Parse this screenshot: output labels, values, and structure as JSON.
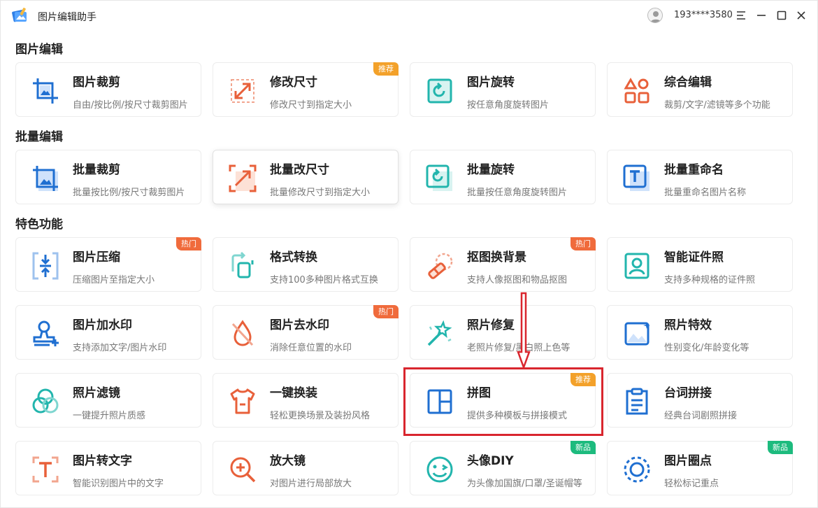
{
  "app": {
    "title": "图片编辑助手",
    "user_id": "193****3580"
  },
  "sections": {
    "edit": {
      "title": "图片编辑"
    },
    "batch": {
      "title": "批量编辑"
    },
    "special": {
      "title": "特色功能"
    }
  },
  "cards": {
    "crop": {
      "name": "图片裁剪",
      "desc": "自由/按比例/按尺寸裁剪图片"
    },
    "resize": {
      "name": "修改尺寸",
      "desc": "修改尺寸到指定大小",
      "badge": "推荐"
    },
    "rotate": {
      "name": "图片旋转",
      "desc": "按任意角度旋转图片"
    },
    "combo": {
      "name": "综合编辑",
      "desc": "裁剪/文字/滤镜等多个功能"
    },
    "batch_crop": {
      "name": "批量裁剪",
      "desc": "批量按比例/按尺寸裁剪图片"
    },
    "batch_resize": {
      "name": "批量改尺寸",
      "desc": "批量修改尺寸到指定大小"
    },
    "batch_rotate": {
      "name": "批量旋转",
      "desc": "批量按任意角度旋转图片"
    },
    "batch_rename": {
      "name": "批量重命名",
      "desc": "批量重命名图片名称"
    },
    "compress": {
      "name": "图片压缩",
      "desc": "压缩图片至指定大小",
      "badge": "热门"
    },
    "convert": {
      "name": "格式转换",
      "desc": "支持100多种图片格式互换"
    },
    "cutout": {
      "name": "抠图换背景",
      "desc": "支持人像抠图和物品抠图",
      "badge": "热门"
    },
    "id_photo": {
      "name": "智能证件照",
      "desc": "支持多种规格的证件照"
    },
    "add_watermark": {
      "name": "图片加水印",
      "desc": "支持添加文字/图片水印"
    },
    "remove_watermark": {
      "name": "图片去水印",
      "desc": "消除任意位置的水印",
      "badge": "热门"
    },
    "repair": {
      "name": "照片修复",
      "desc": "老照片修复/黑白照上色等"
    },
    "effects": {
      "name": "照片特效",
      "desc": "性别变化/年龄变化等"
    },
    "filter": {
      "name": "照片滤镜",
      "desc": "一键提升照片质感"
    },
    "outfit": {
      "name": "一键换装",
      "desc": "轻松更换场景及装扮风格"
    },
    "collage": {
      "name": "拼图",
      "desc": "提供多种模板与拼接模式",
      "badge": "推荐"
    },
    "dialog": {
      "name": "台词拼接",
      "desc": "经典台词剧照拼接"
    },
    "ocr": {
      "name": "图片转文字",
      "desc": "智能识别图片中的文字"
    },
    "magnifier": {
      "name": "放大镜",
      "desc": "对图片进行局部放大"
    },
    "avatar_diy": {
      "name": "头像DIY",
      "desc": "为头像加国旗/口罩/圣诞帽等",
      "badge": "新品"
    },
    "mark": {
      "name": "图片圈点",
      "desc": "轻松标记重点",
      "badge": "新品"
    }
  },
  "colors": {
    "blue": "#1f6fd1",
    "orange": "#e8603a",
    "teal": "#22b5ad",
    "highlight": "#d9262e"
  }
}
